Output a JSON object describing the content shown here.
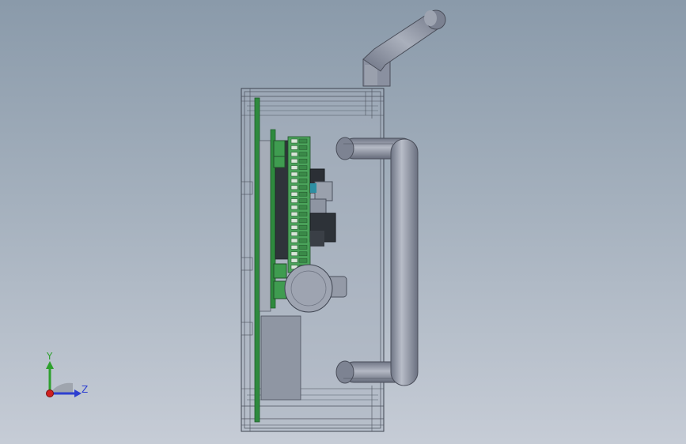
{
  "triad": {
    "y_label": "Y",
    "z_label": "Z",
    "colors": {
      "y": "#2ea02e",
      "z": "#2d3fd0",
      "x": "#d02020"
    }
  },
  "scene": {
    "background_top": "#8a9aaa",
    "background_bottom": "#c6ccd6",
    "parts": [
      "enclosure-wireframe",
      "circuit-board",
      "terminal-blocks",
      "battery-holder",
      "power-module",
      "handle",
      "antenna"
    ]
  }
}
